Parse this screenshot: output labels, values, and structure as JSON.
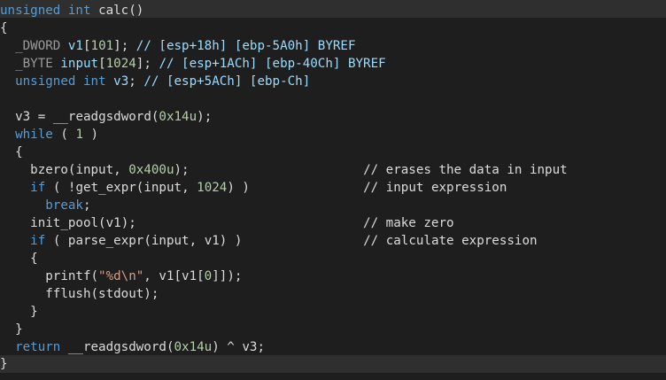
{
  "code_lines": [
    {
      "tokens": [
        {
          "t": "unsigned int calc()",
          "c": "txt"
        }
      ]
    },
    {
      "tokens": [
        {
          "t": "{",
          "c": "txt"
        }
      ]
    },
    {
      "tokens": [
        {
          "t": "  _DWORD v1[101]; // [esp+18h] [ebp-5A0h] BYREF",
          "c": "dim"
        }
      ]
    },
    {
      "tokens": [
        {
          "t": "  _BYTE input[1024]; // [esp+1ACh] [ebp-40Ch] BYREF",
          "c": "dim"
        }
      ]
    },
    {
      "tokens": [
        {
          "t": "  unsigned int v3; // [esp+5ACh] [ebp-Ch]",
          "c": "id"
        }
      ]
    },
    {
      "tokens": [
        {
          "t": "",
          "c": "txt"
        }
      ]
    },
    {
      "tokens": [
        {
          "t": "  v3 = __readgsdword(0x14u);",
          "c": "txt"
        }
      ]
    },
    {
      "tokens": [
        {
          "t": "  while ( 1 )",
          "c": "txt"
        }
      ]
    },
    {
      "tokens": [
        {
          "t": "  {",
          "c": "txt"
        }
      ]
    },
    {
      "tokens": [
        {
          "t": "    bzero(input, 0x400u);",
          "c": "txt"
        },
        {
          "t": "                       // erases the data in input",
          "c": "txt"
        }
      ]
    },
    {
      "tokens": [
        {
          "t": "    if ( !get_expr(input, 1024) )",
          "c": "txt"
        },
        {
          "t": "               // input expression",
          "c": "txt"
        }
      ]
    },
    {
      "tokens": [
        {
          "t": "      break;",
          "c": "txt"
        }
      ]
    },
    {
      "tokens": [
        {
          "t": "    init_pool(v1);",
          "c": "txt"
        },
        {
          "t": "                              // make zero",
          "c": "txt"
        }
      ]
    },
    {
      "tokens": [
        {
          "t": "    if ( parse_expr(input, v1) )",
          "c": "txt"
        },
        {
          "t": "                // calculate expression",
          "c": "txt"
        }
      ]
    },
    {
      "tokens": [
        {
          "t": "    {",
          "c": "txt"
        }
      ]
    },
    {
      "tokens": [
        {
          "t": "      printf(\"%d\\n\", v1[v1[0]]);",
          "c": "txt"
        }
      ]
    },
    {
      "tokens": [
        {
          "t": "      fflush(stdout);",
          "c": "txt"
        }
      ]
    },
    {
      "tokens": [
        {
          "t": "    }",
          "c": "txt"
        }
      ]
    },
    {
      "tokens": [
        {
          "t": "  }",
          "c": "txt"
        }
      ]
    },
    {
      "tokens": [
        {
          "t": "  return __readgsdword(0x14u) ^ v3;",
          "c": "txt"
        }
      ]
    },
    {
      "tokens": [
        {
          "t": "}",
          "c": "txt"
        }
      ]
    }
  ],
  "colors": {
    "background": "#1e1e1e",
    "highlight_line": "#2f2f2f",
    "accent": "#3e8ed0"
  }
}
